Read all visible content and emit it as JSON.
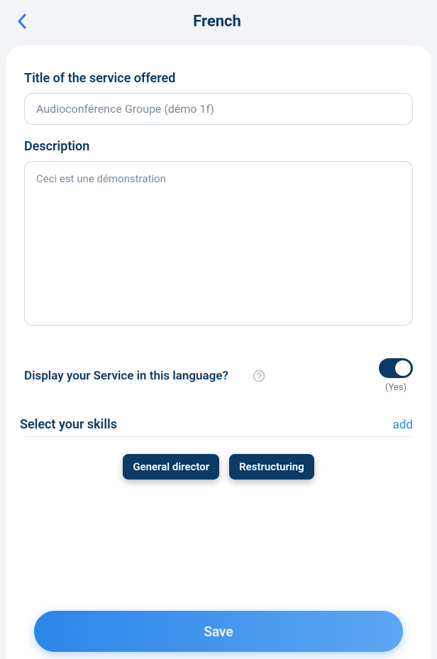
{
  "header": {
    "title": "French"
  },
  "form": {
    "title_label": "Title of the service offered",
    "title_value": "Audioconférence Groupe (démo 1f)",
    "description_label": "Description",
    "description_value": "Ceci est une démonstration"
  },
  "display": {
    "label": "Display your Service in this language?",
    "state_text": "(Yes)"
  },
  "skills": {
    "label": "Select your skills",
    "add_label": "add",
    "items": [
      "General director",
      "Restructuring"
    ]
  },
  "actions": {
    "save_label": "Save"
  }
}
